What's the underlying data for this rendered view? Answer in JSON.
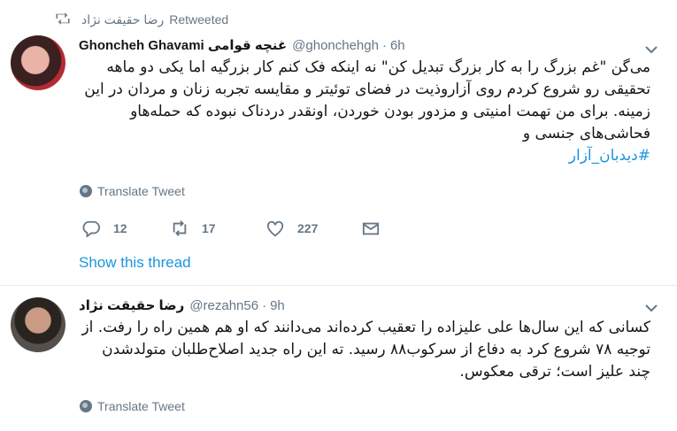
{
  "retweet_banner": {
    "user": "رضا حقیقت نژاد",
    "label": "Retweeted"
  },
  "tweet1": {
    "display_name": "Ghoncheh Ghavami غنچه قوامی",
    "handle": "@ghonchehgh",
    "separator": "·",
    "time": "6h",
    "lines": [
      "می‌گن \"غم بزرگ را به کار بزرگ تبدیل کن\" نه اینکه فک کنم کار بزرگیه اما یکی دو ماهه",
      "تحقیقی رو شروع کردم روی آزاروذیت در فضای توئیتر و مقایسه تجربه زنان و مردان در این",
      "زمینه. برای من تهمت امنیتی و مزدور بودن خوردن، اونقدر دردناک نبوده که حمله‌هاو",
      "فحاشی‌های جنسی و"
    ],
    "hashtag": "#دیدبان_آزار",
    "translate": "Translate Tweet",
    "replies": "12",
    "retweets": "17",
    "likes": "227",
    "show_thread": "Show this thread"
  },
  "tweet2": {
    "display_name": "رضا حقیقت نژاد",
    "handle": "@rezahn56",
    "separator": "·",
    "time": "9h",
    "lines": [
      "کسانی که این سال‌ها علی علیزاده را تعقیب کرده‌اند می‌دانند که او هم همین راه را رفت. از",
      "توجیه ۷۸ شروع کرد به دفاع از سرکوب۸۸ رسید. ته این راه جدید اصلاح‌طلبان متولدشدن",
      "چند علیز است؛ ترقی معکوس."
    ],
    "translate": "Translate Tweet"
  },
  "colors": {
    "link": "#1b95e0",
    "muted": "#657786",
    "text": "#14171a"
  },
  "icons": [
    "retweet-icon",
    "caret-down-icon",
    "globe-icon",
    "reply-icon",
    "like-icon",
    "direct-message-icon"
  ]
}
